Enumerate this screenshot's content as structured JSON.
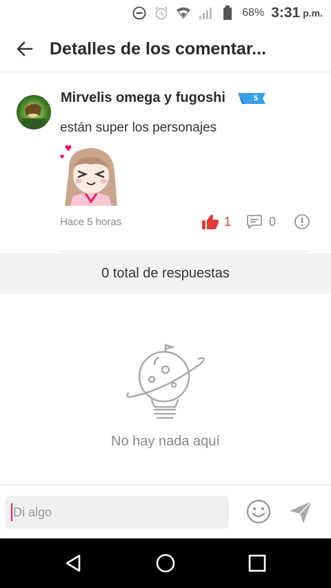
{
  "status_bar": {
    "battery_percent": "68%",
    "time": "3:31",
    "ampm": "p.m.",
    "icons": [
      "dnd-icon",
      "alarm-icon",
      "wifi-icon",
      "signal-icon",
      "battery-icon"
    ]
  },
  "header": {
    "title": "Detalles de los comentar...",
    "back_icon": "arrow-left-icon"
  },
  "comment": {
    "author": "Mirvelis omega y fugoshi",
    "level": "5",
    "text": "están super  los personajes",
    "timestamp": "Hace 5 horas",
    "likes": "1",
    "replies": "0",
    "colors": {
      "like": "#e53935",
      "badge": "#3aa0e8"
    }
  },
  "replies_bar": {
    "label": "0 total de respuestas"
  },
  "empty_state": {
    "message": "No hay nada aquí"
  },
  "composer": {
    "placeholder": "Di algo",
    "emoji_icon": "smiley-icon",
    "send_icon": "paper-plane-icon"
  },
  "nav": {
    "buttons": [
      "back-triangle-icon",
      "home-circle-icon",
      "recents-square-icon"
    ]
  }
}
